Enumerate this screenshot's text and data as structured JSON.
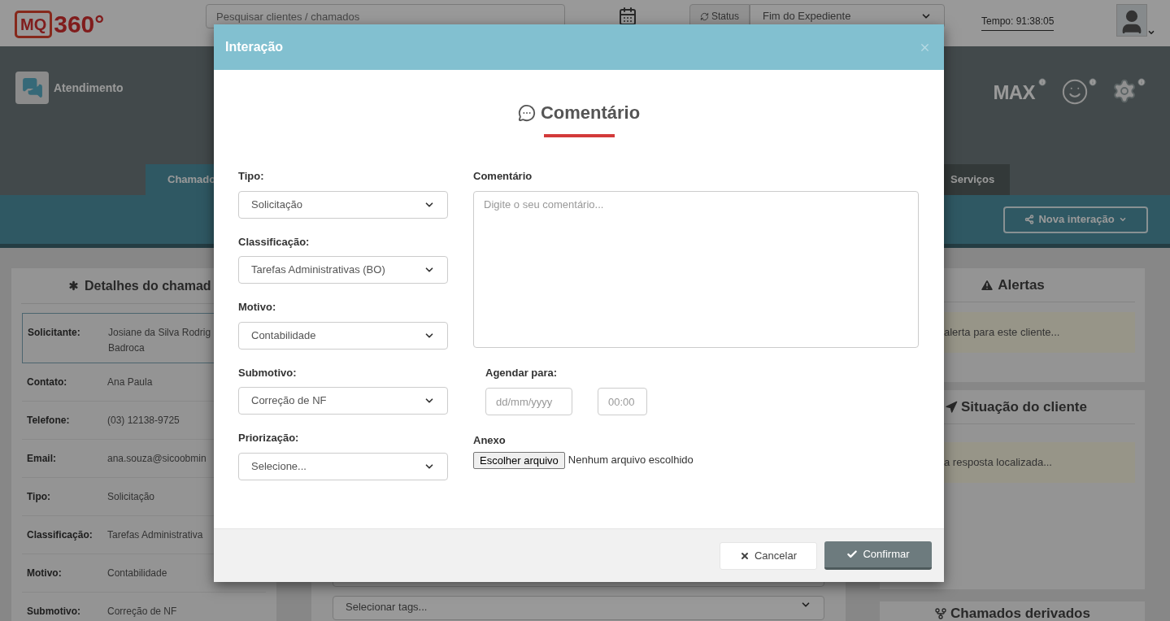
{
  "header": {
    "logo": {
      "mark": "MQ",
      "number": "360°"
    },
    "search": {
      "placeholder": "Pesquisar clientes / chamados"
    },
    "status": {
      "button": "Status",
      "value": "Fim do Expediente"
    },
    "timer": "Tempo: 91:38:05"
  },
  "banner": {
    "section": "Atendimento",
    "badge": "MAX",
    "tabs": [
      {
        "label": "Chamado",
        "selected": true
      },
      {
        "label": "Serviços",
        "selected": false
      }
    ],
    "action": "Nova interação"
  },
  "details": {
    "title": "Detalhes do chamad",
    "rows": [
      {
        "label": "Solicitante:",
        "lines": [
          "Josiane da Silva Rodrig",
          "Badroca"
        ],
        "selected": true
      },
      {
        "label": "Contato:",
        "lines": [
          "Ana Paula"
        ],
        "selected": false
      },
      {
        "label": "Telefone:",
        "lines": [
          "(03) 12138-9725"
        ],
        "selected": false
      },
      {
        "label": "Email:",
        "lines": [
          "ana.souza@sicoobmin"
        ],
        "selected": false
      },
      {
        "label": "Tipo:",
        "lines": [
          "Solicitação"
        ],
        "selected": false
      },
      {
        "label": "Classificação:",
        "lines": [
          "Tarefas Administrativa"
        ],
        "selected": false
      },
      {
        "label": "Motivo:",
        "lines": [
          "Contabilidade"
        ],
        "selected": false
      },
      {
        "label": "Submotivo:",
        "lines": [
          "Correção de NF"
        ],
        "selected": false
      }
    ]
  },
  "tags_select": {
    "value": "Selecionar tags..."
  },
  "side_cards": [
    {
      "kind": "alert",
      "title": "Alertas",
      "message": "alerta para este cliente..."
    },
    {
      "kind": "status",
      "title": "Situação do cliente",
      "message": "a resposta localizada..."
    },
    {
      "kind": "branch",
      "title": "Chamados derivados"
    }
  ],
  "modal": {
    "title": "Interação",
    "heading": "Comentário",
    "fields": [
      {
        "label": "Tipo:",
        "value": "Solicitação"
      },
      {
        "label": "Classificação:",
        "value": "Tarefas Administrativas (BO)"
      },
      {
        "label": "Motivo:",
        "value": "Contabilidade"
      },
      {
        "label": "Submotivo:",
        "value": "Correção de NF"
      },
      {
        "label": "Priorização:",
        "value": "Selecione..."
      }
    ],
    "comment": {
      "label": "Comentário",
      "placeholder": "Digite o seu comentário..."
    },
    "schedule": {
      "label": "Agendar para:",
      "date_placeholder": "dd/mm/yyyy",
      "time_placeholder": "00:00"
    },
    "attachment": {
      "label": "Anexo",
      "button": "Escolher arquivo",
      "status": "Nenhum arquivo escolhido"
    },
    "buttons": [
      {
        "kind": "secondary",
        "label": "Cancelar"
      },
      {
        "kind": "primary",
        "label": "Confirmar"
      }
    ]
  }
}
